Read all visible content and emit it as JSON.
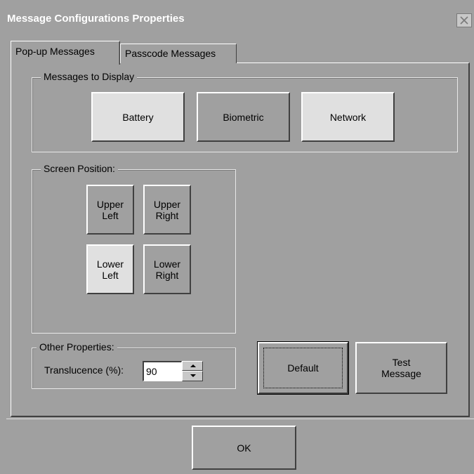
{
  "window": {
    "title": "Message Configurations Properties"
  },
  "tabs": [
    {
      "label": "Pop-up Messages",
      "active": true
    },
    {
      "label": "Passcode Messages",
      "active": false
    }
  ],
  "messages_group": {
    "label": "Messages to Display",
    "buttons": [
      {
        "label": "Battery",
        "selected": true
      },
      {
        "label": "Biometric",
        "selected": false
      },
      {
        "label": "Network",
        "selected": true
      }
    ]
  },
  "position_group": {
    "label": "Screen Position:",
    "buttons": [
      {
        "line1": "Upper",
        "line2": "Left",
        "selected": false
      },
      {
        "line1": "Upper",
        "line2": "Right",
        "selected": false
      },
      {
        "line1": "Lower",
        "line2": "Left",
        "selected": true
      },
      {
        "line1": "Lower",
        "line2": "Right",
        "selected": false
      }
    ]
  },
  "other_group": {
    "label": "Other Properties:",
    "translucence_label": "Translucence (%):",
    "translucence_value": "90"
  },
  "actions": {
    "default_label": "Default",
    "test_line1": "Test",
    "test_line2": "Message",
    "ok_label": "OK"
  },
  "colors": {
    "face": "#a0a0a0",
    "selected_face": "#e0e0e0",
    "title_text": "#ffffff"
  },
  "icons": {
    "close": "close-icon"
  }
}
